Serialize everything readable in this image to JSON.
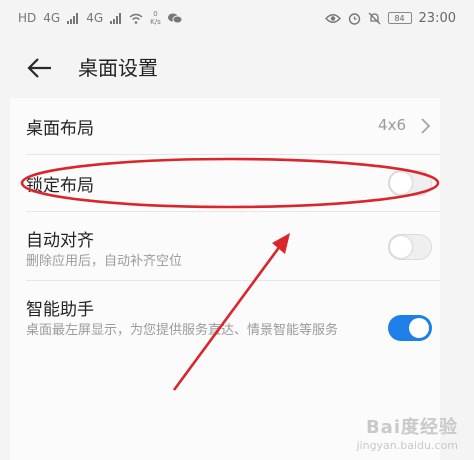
{
  "status_bar": {
    "sim_badge": "HD",
    "signal_1": "4G",
    "signal_2": "4G",
    "speed_value": "0",
    "speed_unit": "K/s",
    "battery": "84",
    "time": "23:00"
  },
  "header": {
    "title": "桌面设置"
  },
  "settings": {
    "layout": {
      "title": "桌面布局",
      "value": "4x6"
    },
    "lock_layout": {
      "title": "锁定布局",
      "enabled": false
    },
    "auto_align": {
      "title": "自动对齐",
      "subtitle": "删除应用后，自动补齐空位",
      "enabled": false
    },
    "smart_assistant": {
      "title": "智能助手",
      "subtitle": "桌面最左屏显示，为您提供服务直达、情景智能等服务",
      "enabled": true
    }
  },
  "watermark": {
    "text": "Bai度经验",
    "sub": "jingyan.baidu.com"
  },
  "colors": {
    "toggle_on": "#1e7fe6",
    "annotation": "#d9252b"
  }
}
